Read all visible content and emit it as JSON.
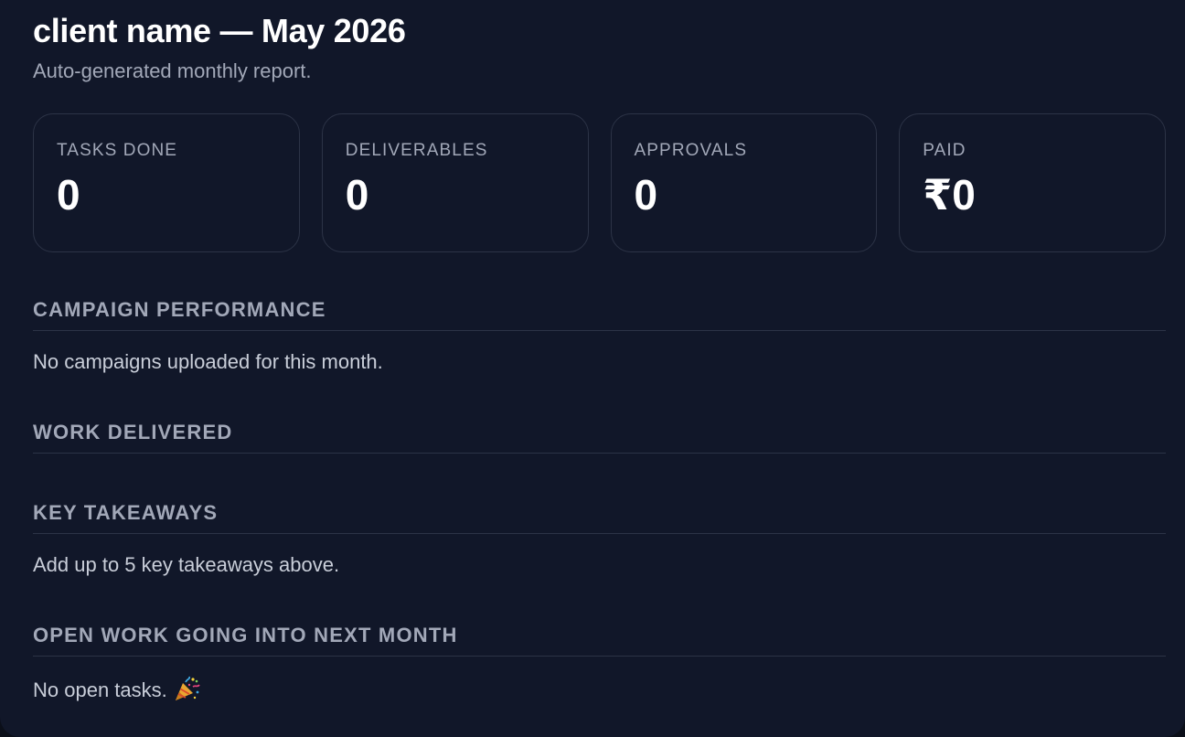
{
  "header": {
    "title": "client name — May 2026",
    "subtitle": "Auto-generated monthly report."
  },
  "stats": [
    {
      "label": "TASKS DONE",
      "value": "0"
    },
    {
      "label": "DELIVERABLES",
      "value": "0"
    },
    {
      "label": "APPROVALS",
      "value": "0"
    },
    {
      "label": "PAID",
      "value": "₹0"
    }
  ],
  "sections": {
    "campaign_performance": {
      "heading": "CAMPAIGN PERFORMANCE",
      "text": "No campaigns uploaded for this month."
    },
    "work_delivered": {
      "heading": "WORK DELIVERED"
    },
    "key_takeaways": {
      "heading": "KEY TAKEAWAYS",
      "text": "Add up to 5 key takeaways above."
    },
    "open_work": {
      "heading": "OPEN WORK GOING INTO NEXT MONTH",
      "text": "No open tasks.",
      "icon": "party-popper-icon"
    }
  },
  "colors": {
    "background": "#111729",
    "card_border": "#2c3346",
    "title": "#ffffff",
    "muted_text": "#a2a8b8",
    "body_text": "#c9ced9"
  }
}
